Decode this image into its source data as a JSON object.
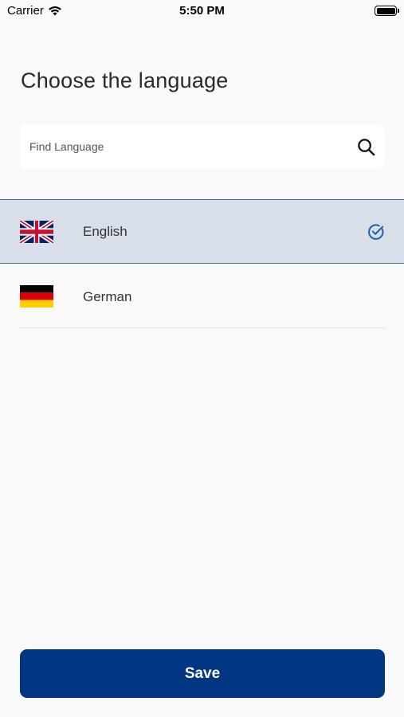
{
  "status_bar": {
    "carrier": "Carrier",
    "time": "5:50 PM",
    "wifi_icon": "wifi-icon",
    "battery_icon": "battery-icon"
  },
  "page_title": "Choose the language",
  "search": {
    "placeholder": "Find Language",
    "value": "",
    "icon": "search-icon"
  },
  "languages": [
    {
      "label": "English",
      "flag_icon": "uk-flag-icon",
      "selected": true,
      "selected_icon": "check-circle-icon"
    },
    {
      "label": "German",
      "flag_icon": "germany-flag-icon",
      "selected": false
    }
  ],
  "save_button": {
    "label": "Save"
  },
  "colors": {
    "background": "#f9f9fa",
    "selected_row": "#d9dfe9",
    "selected_border": "#4a6ea0",
    "accent": "#003682",
    "check": "#1f5fae"
  }
}
